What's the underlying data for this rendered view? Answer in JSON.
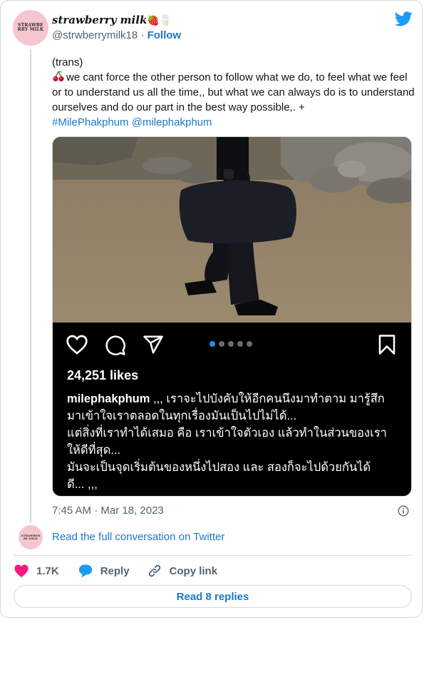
{
  "author": {
    "display_name": "strawberry milk",
    "name_emojis": "🍓🥛",
    "handle": "@strwberrymilk18",
    "separator": "·",
    "follow_label": "Follow",
    "avatar_text": "STRAWBERRY MILK"
  },
  "tweet": {
    "line1": "(trans)",
    "body": "we cant force the other person to follow what we do, to feel what we feel or to understand us all the time,, but what we can always do is to understand ourselves and do our part in the best way possible,. +",
    "hashtag": "#MilePhakphum",
    "mention": "@milephakphum"
  },
  "instagram": {
    "likes": "24,251 likes",
    "username": "milephakphum",
    "caption_lines": [
      ",,, เราจะไปบังคับให้อีกคนนึงมาทำตาม มารู้สึก",
      "มาเข้าใจเราตลอดในทุกเรื่องมันเป็นไปไม่ได้...",
      "แต่สิ่งที่เราทำได้เสมอ คือ เราเข้าใจตัวเอง แล้วทำในส่วนของเรา",
      "ให้ดีที่สุด...",
      "มันจะเป็นจุดเริ่มต้นของหนึ่งไปสอง และ สองก็จะไปด้วยกันได้",
      "ดี... ,,,"
    ],
    "carousel_count": 5,
    "carousel_active": 0
  },
  "meta": {
    "timestamp": "7:45 AM · Mar 18, 2023",
    "read_conversation": "Read the full conversation on Twitter"
  },
  "actions": {
    "like_count": "1.7K",
    "reply_label": "Reply",
    "copy_label": "Copy link",
    "read_replies": "Read 8 replies"
  },
  "colors": {
    "link": "#1d77c6",
    "heart": "#f91880",
    "reply": "#1d9bf0",
    "twitter_blue": "#1d9bf0"
  }
}
